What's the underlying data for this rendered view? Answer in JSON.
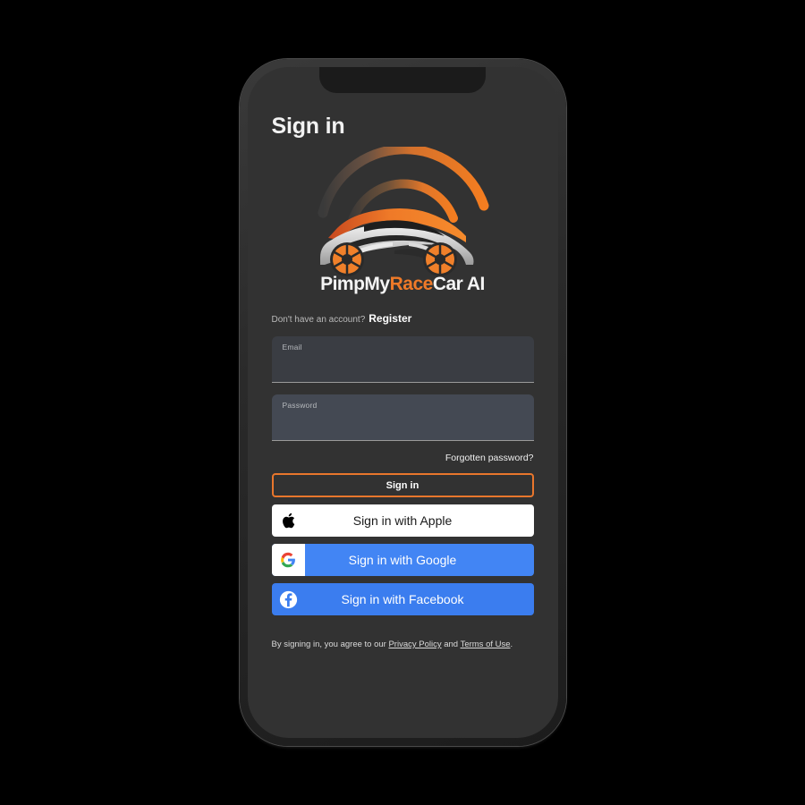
{
  "page": {
    "title": "Sign in"
  },
  "brand": {
    "logo_icon": "race-car-wifi-logo",
    "wordmark_part1": "PimpMy",
    "wordmark_part2": "Race",
    "wordmark_part3": "Car AI",
    "accent_color": "#ef7a28",
    "orange_button_border": "#e8762c"
  },
  "register": {
    "prompt": "Don't have an account?",
    "link": "Register"
  },
  "form": {
    "email": {
      "label": "Email",
      "value": "",
      "placeholder": ""
    },
    "password": {
      "label": "Password",
      "value": "",
      "placeholder": ""
    },
    "forgot_password": "Forgotten password?",
    "submit": "Sign in"
  },
  "social": [
    {
      "label": "Sign in with Apple",
      "icon": "apple-icon",
      "background": "#ffffff",
      "text_color": "#1a1a1a"
    },
    {
      "label": "Sign in with Google",
      "icon": "google-icon",
      "background": "#4285f4",
      "text_color": "#ffffff"
    },
    {
      "label": "Sign in with Facebook",
      "icon": "facebook-icon",
      "background": "#3b7def",
      "text_color": "#ffffff"
    }
  ],
  "legal": {
    "prefix": "By signing in, you agree to our ",
    "privacy_policy": "Privacy Policy",
    "conjunction": " and ",
    "terms_of_use": "Terms of Use",
    "suffix": "."
  }
}
